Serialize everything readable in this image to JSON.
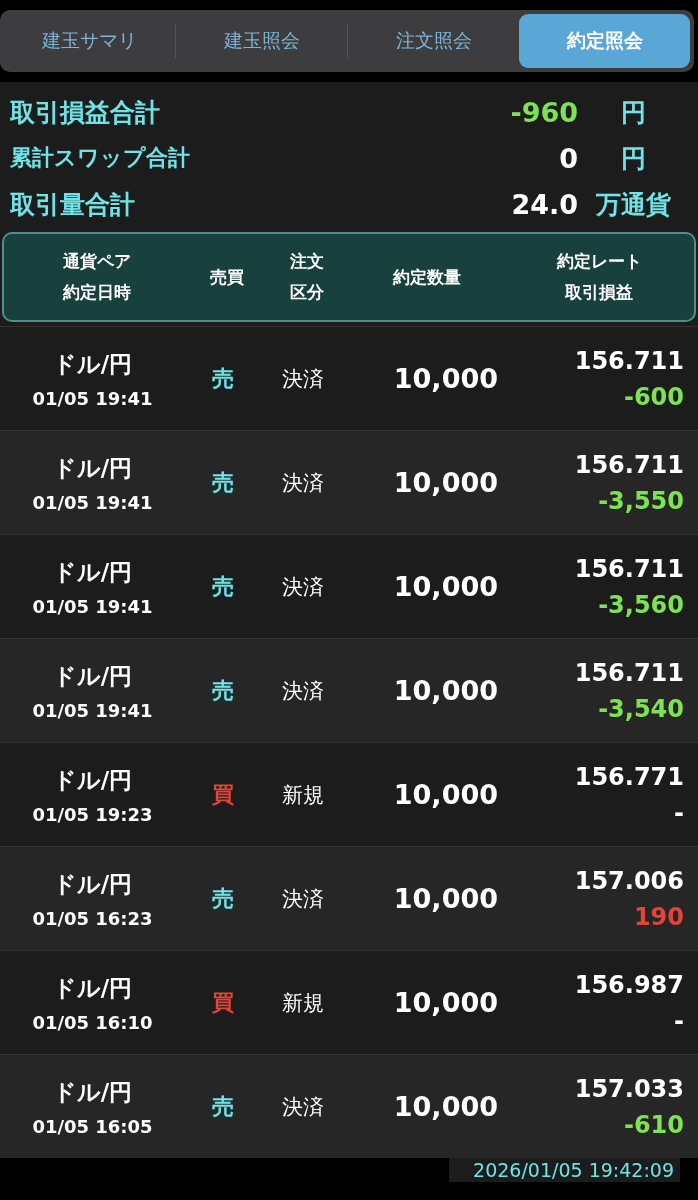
{
  "tabs": [
    {
      "label": "建玉サマリ",
      "selected": false
    },
    {
      "label": "建玉照会",
      "selected": false
    },
    {
      "label": "注文照会",
      "selected": false
    },
    {
      "label": "約定照会",
      "selected": true
    }
  ],
  "summary": [
    {
      "label": "取引損益合計",
      "value": {
        "text": "-960",
        "kind": "loss"
      },
      "unit": "円",
      "emphasis": true
    },
    {
      "label": "累計スワップ合計",
      "value": {
        "text": "0",
        "kind": "plain"
      },
      "unit": "円",
      "emphasis": false
    },
    {
      "label": "取引量合計",
      "value": {
        "text": "24.0",
        "kind": "plain"
      },
      "unit": "万通貨",
      "emphasis": true
    }
  ],
  "table": {
    "columns": [
      {
        "lines": [
          "通貨ペア",
          "約定日時"
        ]
      },
      {
        "lines": [
          "売買"
        ]
      },
      {
        "lines": [
          "注文",
          "区分"
        ]
      },
      {
        "lines": [
          "約定数量"
        ]
      },
      {
        "lines": [
          "約定レート",
          "取引損益"
        ]
      }
    ],
    "rows": [
      {
        "pair": "ドル/円",
        "time": "01/05 19:41",
        "side": {
          "text": "売",
          "kind": "sell"
        },
        "type": "決済",
        "quantity": "10,000",
        "rate": "156.711",
        "pl": {
          "text": "-600",
          "kind": "loss"
        }
      },
      {
        "pair": "ドル/円",
        "time": "01/05 19:41",
        "side": {
          "text": "売",
          "kind": "sell"
        },
        "type": "決済",
        "quantity": "10,000",
        "rate": "156.711",
        "pl": {
          "text": "-3,550",
          "kind": "loss"
        }
      },
      {
        "pair": "ドル/円",
        "time": "01/05 19:41",
        "side": {
          "text": "売",
          "kind": "sell"
        },
        "type": "決済",
        "quantity": "10,000",
        "rate": "156.711",
        "pl": {
          "text": "-3,560",
          "kind": "loss"
        }
      },
      {
        "pair": "ドル/円",
        "time": "01/05 19:41",
        "side": {
          "text": "売",
          "kind": "sell"
        },
        "type": "決済",
        "quantity": "10,000",
        "rate": "156.711",
        "pl": {
          "text": "-3,540",
          "kind": "loss"
        }
      },
      {
        "pair": "ドル/円",
        "time": "01/05 19:23",
        "side": {
          "text": "買",
          "kind": "buy"
        },
        "type": "新規",
        "quantity": "10,000",
        "rate": "156.771",
        "pl": {
          "text": "-",
          "kind": "none"
        }
      },
      {
        "pair": "ドル/円",
        "time": "01/05 16:23",
        "side": {
          "text": "売",
          "kind": "sell"
        },
        "type": "決済",
        "quantity": "10,000",
        "rate": "157.006",
        "pl": {
          "text": "190",
          "kind": "gain"
        }
      },
      {
        "pair": "ドル/円",
        "time": "01/05 16:10",
        "side": {
          "text": "買",
          "kind": "buy"
        },
        "type": "新規",
        "quantity": "10,000",
        "rate": "156.987",
        "pl": {
          "text": "-",
          "kind": "none"
        }
      },
      {
        "pair": "ドル/円",
        "time": "01/05 16:05",
        "side": {
          "text": "売",
          "kind": "sell"
        },
        "type": "決済",
        "quantity": "10,000",
        "rate": "157.033",
        "pl": {
          "text": "-610",
          "kind": "loss"
        }
      }
    ]
  },
  "updated_at": "2026/01/05 19:42:09"
}
